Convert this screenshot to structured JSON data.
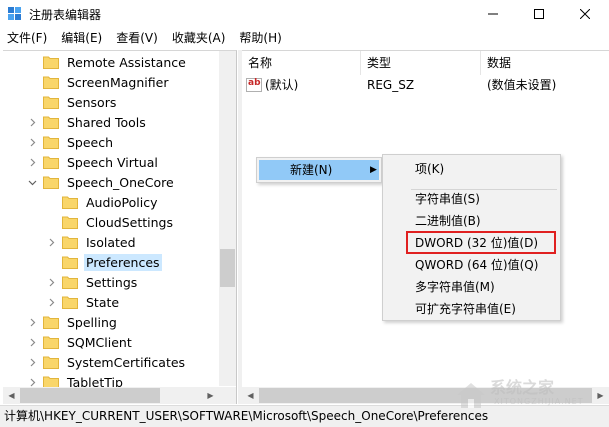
{
  "window": {
    "title": "注册表编辑器"
  },
  "menubar": [
    "文件(F)",
    "编辑(E)",
    "查看(V)",
    "收藏夹(A)",
    "帮助(H)"
  ],
  "tree": [
    {
      "label": "Remote Assistance",
      "expandable": false,
      "expanded": false,
      "level": 0,
      "selected": false
    },
    {
      "label": "ScreenMagnifier",
      "expandable": false,
      "expanded": false,
      "level": 0,
      "selected": false
    },
    {
      "label": "Sensors",
      "expandable": false,
      "expanded": false,
      "level": 0,
      "selected": false
    },
    {
      "label": "Shared Tools",
      "expandable": true,
      "expanded": false,
      "level": 0,
      "selected": false
    },
    {
      "label": "Speech",
      "expandable": true,
      "expanded": false,
      "level": 0,
      "selected": false
    },
    {
      "label": "Speech Virtual",
      "expandable": true,
      "expanded": false,
      "level": 0,
      "selected": false
    },
    {
      "label": "Speech_OneCore",
      "expandable": true,
      "expanded": true,
      "level": 0,
      "selected": false
    },
    {
      "label": "AudioPolicy",
      "expandable": false,
      "expanded": false,
      "level": 1,
      "selected": false
    },
    {
      "label": "CloudSettings",
      "expandable": false,
      "expanded": false,
      "level": 1,
      "selected": false
    },
    {
      "label": "Isolated",
      "expandable": true,
      "expanded": false,
      "level": 1,
      "selected": false
    },
    {
      "label": "Preferences",
      "expandable": false,
      "expanded": false,
      "level": 1,
      "selected": true
    },
    {
      "label": "Settings",
      "expandable": true,
      "expanded": false,
      "level": 1,
      "selected": false
    },
    {
      "label": "State",
      "expandable": true,
      "expanded": false,
      "level": 1,
      "selected": false
    },
    {
      "label": "Spelling",
      "expandable": true,
      "expanded": false,
      "level": 0,
      "selected": false
    },
    {
      "label": "SQMClient",
      "expandable": true,
      "expanded": false,
      "level": 0,
      "selected": false
    },
    {
      "label": "SystemCertificates",
      "expandable": true,
      "expanded": false,
      "level": 0,
      "selected": false
    },
    {
      "label": "TabletTip",
      "expandable": true,
      "expanded": false,
      "level": 0,
      "selected": false
    }
  ],
  "list": {
    "columns": {
      "name": "名称",
      "type": "类型",
      "data": "数据"
    },
    "rows": [
      {
        "name": "(默认)",
        "type": "REG_SZ",
        "data": "(数值未设置)"
      }
    ]
  },
  "context_menu": {
    "new_label": "新建(N)",
    "new_arrow": "▶",
    "submenu": {
      "key": "项(K)",
      "string": "字符串值(S)",
      "binary": "二进制值(B)",
      "dword": "DWORD (32 位)值(D)",
      "qword": "QWORD (64 位)值(Q)",
      "multi_string": "多字符串值(M)",
      "expandable_string": "可扩充字符串值(E)"
    }
  },
  "statusbar": {
    "path": "计算机\\HKEY_CURRENT_USER\\SOFTWARE\\Microsoft\\Speech_OneCore\\Preferences"
  },
  "watermark": {
    "text": "系统之家",
    "url": "XITONGZHIJIA.NET"
  },
  "colors": {
    "selection": "#cce8ff",
    "menu_highlight": "#91c9f7",
    "folder": "#f9d66a",
    "highlight_box": "#e02020"
  }
}
